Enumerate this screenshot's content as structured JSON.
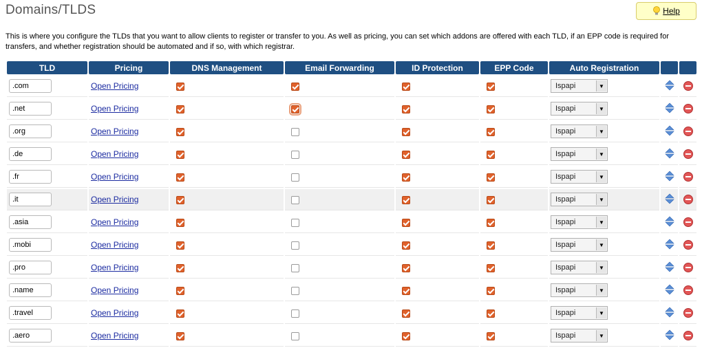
{
  "page": {
    "title": "Domains/TLDS",
    "help_label": "Help",
    "intro": "This is where you configure the TLDs that you want to allow clients to register or transfer to you. As well as pricing, you can set which addons are offered with each TLD, if an EPP code is required for transfers, and whether registration should be automated and if so, with which registrar."
  },
  "table": {
    "headers": {
      "tld": "TLD",
      "pricing": "Pricing",
      "dns": "DNS Management",
      "email": "Email Forwarding",
      "idp": "ID Protection",
      "epp": "EPP Code",
      "auto": "Auto Registration"
    },
    "pricing_link": "Open Pricing",
    "rows": [
      {
        "tld": ".com",
        "dns": true,
        "email": true,
        "idp": true,
        "epp": true,
        "registrar": "Ispapi"
      },
      {
        "tld": ".net",
        "dns": true,
        "email": true,
        "idp": true,
        "epp": true,
        "registrar": "Ispapi"
      },
      {
        "tld": ".org",
        "dns": true,
        "email": false,
        "idp": true,
        "epp": true,
        "registrar": "Ispapi"
      },
      {
        "tld": ".de",
        "dns": true,
        "email": false,
        "idp": true,
        "epp": true,
        "registrar": "Ispapi"
      },
      {
        "tld": ".fr",
        "dns": true,
        "email": false,
        "idp": true,
        "epp": true,
        "registrar": "Ispapi"
      },
      {
        "tld": ".it",
        "dns": true,
        "email": false,
        "idp": true,
        "epp": true,
        "registrar": "Ispapi"
      },
      {
        "tld": ".asia",
        "dns": true,
        "email": false,
        "idp": true,
        "epp": true,
        "registrar": "Ispapi"
      },
      {
        "tld": ".mobi",
        "dns": true,
        "email": false,
        "idp": true,
        "epp": true,
        "registrar": "Ispapi"
      },
      {
        "tld": ".pro",
        "dns": true,
        "email": false,
        "idp": true,
        "epp": true,
        "registrar": "Ispapi"
      },
      {
        "tld": ".name",
        "dns": true,
        "email": false,
        "idp": true,
        "epp": true,
        "registrar": "Ispapi"
      },
      {
        "tld": ".travel",
        "dns": true,
        "email": false,
        "idp": true,
        "epp": true,
        "registrar": "Ispapi"
      },
      {
        "tld": ".aero",
        "dns": true,
        "email": false,
        "idp": true,
        "epp": true,
        "registrar": "Ispapi"
      }
    ]
  },
  "colors": {
    "header_bg": "#1f4f82",
    "checkbox_checked": "#e0622c",
    "help_bg": "#ffffc8",
    "row_highlight": "#f0f0f0"
  },
  "icons": {
    "help": "lightbulb-icon",
    "sort": "sort-arrows-icon",
    "delete": "delete-icon",
    "dropdown": "chevron-down-icon"
  }
}
